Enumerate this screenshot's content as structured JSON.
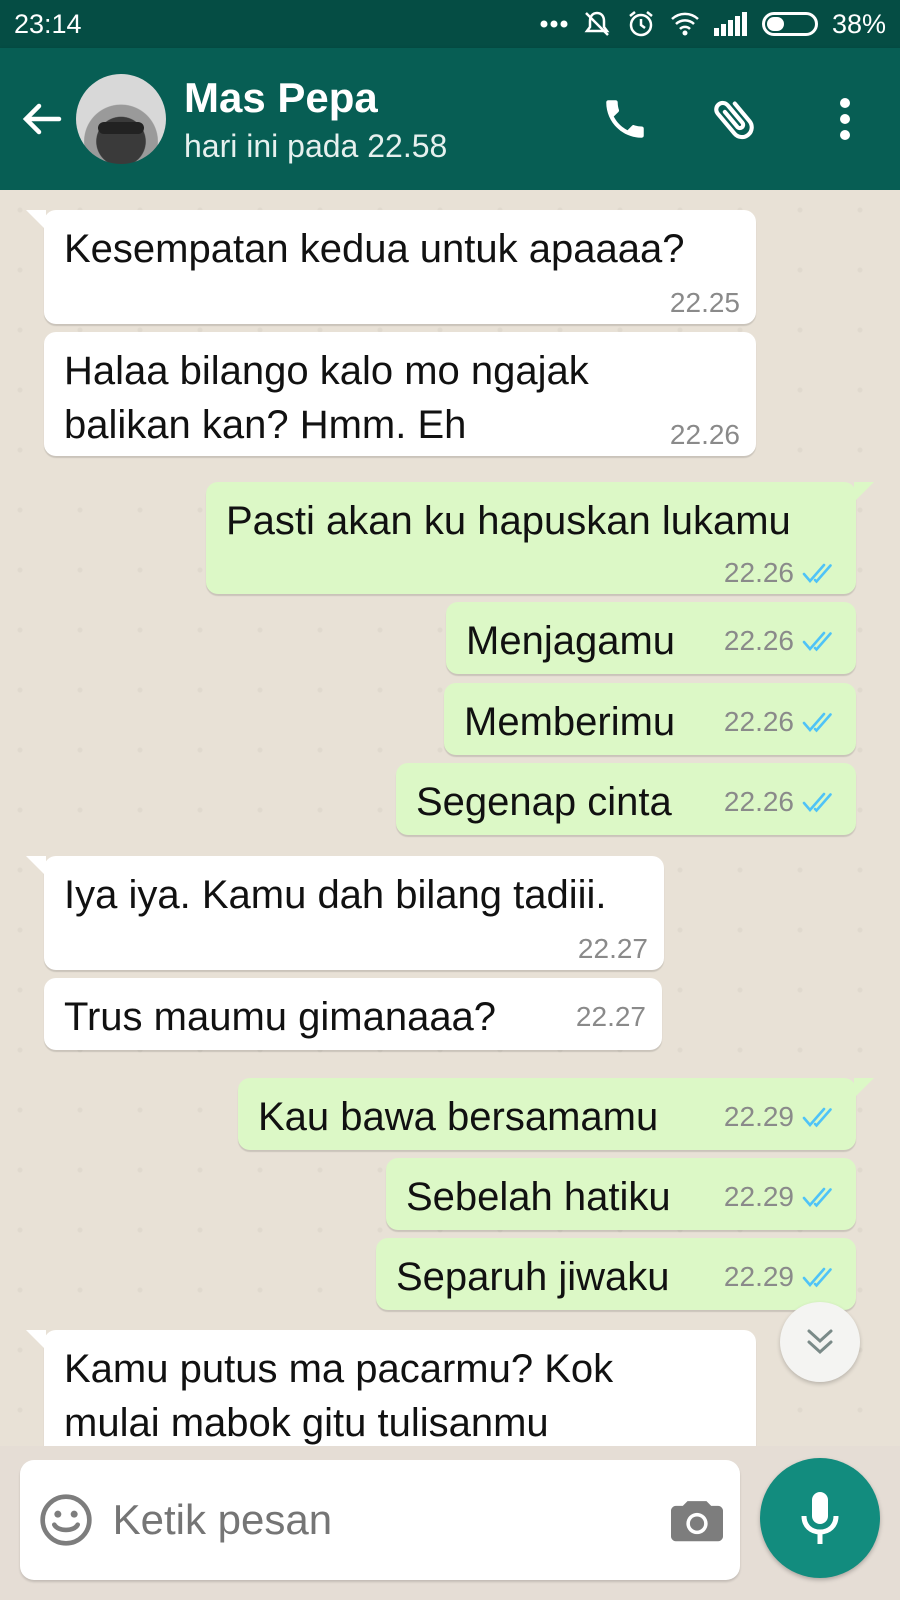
{
  "status_bar": {
    "time": "23:14",
    "battery": "38%",
    "battery_level": 0.38
  },
  "header": {
    "contact_name": "Mas Pepa",
    "last_seen": "hari ini pada 22.58"
  },
  "messages": [
    {
      "dir": "in",
      "text": "Kesempatan kedua untuk apaaaa?",
      "time": "22.25"
    },
    {
      "dir": "in",
      "text": "Halaa bilango kalo mo ngajak balikan kan? Hmm. Eh",
      "time": "22.26"
    },
    {
      "dir": "out",
      "text": "Pasti akan ku hapuskan lukamu",
      "time": "22.26",
      "status": "read"
    },
    {
      "dir": "out",
      "text": "Menjagamu",
      "time": "22.26",
      "status": "read"
    },
    {
      "dir": "out",
      "text": "Memberimu",
      "time": "22.26",
      "status": "read"
    },
    {
      "dir": "out",
      "text": "Segenap cinta",
      "time": "22.26",
      "status": "read"
    },
    {
      "dir": "in",
      "text": "Iya iya. Kamu dah bilang tadiii.",
      "time": "22.27"
    },
    {
      "dir": "in",
      "text": "Trus maumu gimanaaa?",
      "time": "22.27"
    },
    {
      "dir": "out",
      "text": "Kau bawa bersamamu",
      "time": "22.29",
      "status": "read"
    },
    {
      "dir": "out",
      "text": "Sebelah hatiku",
      "time": "22.29",
      "status": "read"
    },
    {
      "dir": "out",
      "text": "Separuh jiwaku",
      "time": "22.29",
      "status": "read"
    },
    {
      "dir": "in",
      "text": "Kamu putus ma pacarmu? Kok mulai mabok gitu tulisanmu",
      "time": ""
    }
  ],
  "composer": {
    "placeholder": "Ketik pesan"
  },
  "colors": {
    "header": "#075e54",
    "status_bar": "#054d44",
    "outgoing_bubble": "#dcf8c6",
    "incoming_bubble": "#ffffff",
    "read_ticks": "#4fc3f7",
    "mic_button": "#128c7e"
  },
  "icons": [
    "back-arrow-icon",
    "phone-icon",
    "paperclip-icon",
    "more-vert-icon",
    "emoji-icon",
    "camera-icon",
    "mic-icon",
    "double-chevron-down-icon"
  ]
}
